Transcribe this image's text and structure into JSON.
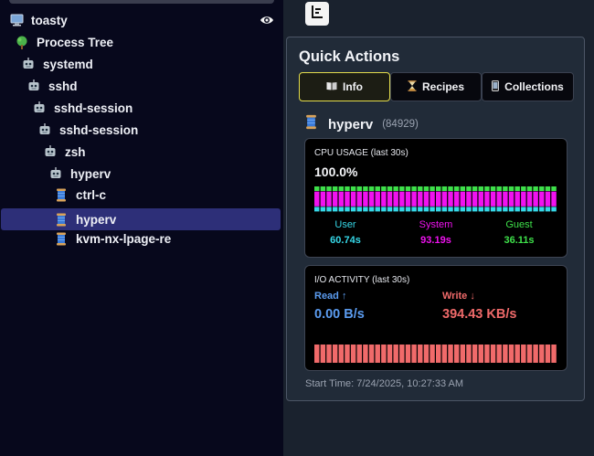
{
  "tree": {
    "host": "toasty",
    "items": [
      {
        "label": "Process Tree",
        "icon": "tree-icon"
      },
      {
        "label": "systemd",
        "icon": "robot-icon"
      },
      {
        "label": "sshd",
        "icon": "robot-icon"
      },
      {
        "label": "sshd-session",
        "icon": "robot-icon"
      },
      {
        "label": "sshd-session",
        "icon": "robot-icon"
      },
      {
        "label": "zsh",
        "icon": "robot-icon"
      },
      {
        "label": "hyperv",
        "icon": "robot-icon"
      },
      {
        "label": "ctrl-c",
        "icon": "spool-icon"
      },
      {
        "label": "hyperv",
        "icon": "spool-icon"
      },
      {
        "label": "kvm-nx-lpage-re",
        "icon": "spool-icon"
      }
    ]
  },
  "quick_actions": {
    "title": "Quick Actions",
    "tabs": [
      {
        "label": "Info",
        "icon": "book-icon"
      },
      {
        "label": "Recipes",
        "icon": "hourglass-icon"
      },
      {
        "label": "Collections",
        "icon": "phone-icon"
      }
    ],
    "active_tab": "Info",
    "process": {
      "name": "hyperv",
      "pid": "(84929)"
    },
    "cpu": {
      "title": "CPU USAGE (last 30s)",
      "value": "100.0%",
      "user_label": "User",
      "user_value": "60.74s",
      "system_label": "System",
      "system_value": "93.19s",
      "guest_label": "Guest",
      "guest_value": "36.11s"
    },
    "io": {
      "title": "I/O ACTIVITY (last 30s)",
      "read_label": "Read ↑",
      "read_value": "0.00 B/s",
      "write_label": "Write ↓",
      "write_value": "394.43 KB/s"
    },
    "start_time": "Start Time: 7/24/2025, 10:27:33 AM"
  },
  "colors": {
    "user": "#36d8e8",
    "system": "#f012f0",
    "guest": "#3ee04a",
    "read": "#5b9cf0",
    "write": "#f06a6a",
    "selected_row": "#2d2f78",
    "active_tab_border": "#e4dd4c"
  },
  "chart_data": [
    {
      "type": "bar",
      "title": "CPU USAGE (last 30s)",
      "series": [
        {
          "name": "User",
          "values": [
            1,
            1,
            1,
            1,
            1,
            1,
            1,
            1,
            1,
            1,
            1,
            1,
            1,
            1,
            1,
            1,
            1,
            1,
            1,
            1,
            1,
            1,
            1,
            1,
            1,
            1,
            1,
            1,
            1,
            1,
            1,
            1,
            1,
            1,
            1,
            1,
            1,
            1,
            1,
            1
          ]
        },
        {
          "name": "System",
          "values": [
            3,
            3,
            3,
            3,
            3,
            3,
            3,
            3,
            3,
            3,
            3,
            3,
            3,
            3,
            3,
            3,
            3,
            3,
            3,
            3,
            3,
            3,
            3,
            3,
            3,
            3,
            3,
            3,
            3,
            3,
            3,
            3,
            3,
            3,
            3,
            3,
            3,
            3,
            3,
            3
          ]
        },
        {
          "name": "Guest",
          "values": [
            1,
            1,
            1,
            1,
            1,
            1,
            1,
            1,
            1,
            1,
            1,
            1,
            1,
            1,
            1,
            1,
            1,
            1,
            1,
            1,
            1,
            1,
            1,
            1,
            1,
            1,
            1,
            1,
            1,
            1,
            1,
            1,
            1,
            1,
            1,
            1,
            1,
            1,
            1,
            1
          ]
        }
      ]
    },
    {
      "type": "bar",
      "title": "I/O ACTIVITY (last 30s)",
      "series": [
        {
          "name": "Write ↓",
          "values": [
            1,
            1,
            1,
            1,
            1,
            1,
            1,
            1,
            1,
            1,
            1,
            1,
            1,
            1,
            1,
            1,
            1,
            1,
            1,
            1,
            1,
            1,
            1,
            1,
            1,
            1,
            1,
            1,
            1,
            1,
            1,
            1,
            1,
            1,
            1,
            1,
            1,
            1,
            1,
            1
          ]
        }
      ]
    }
  ]
}
